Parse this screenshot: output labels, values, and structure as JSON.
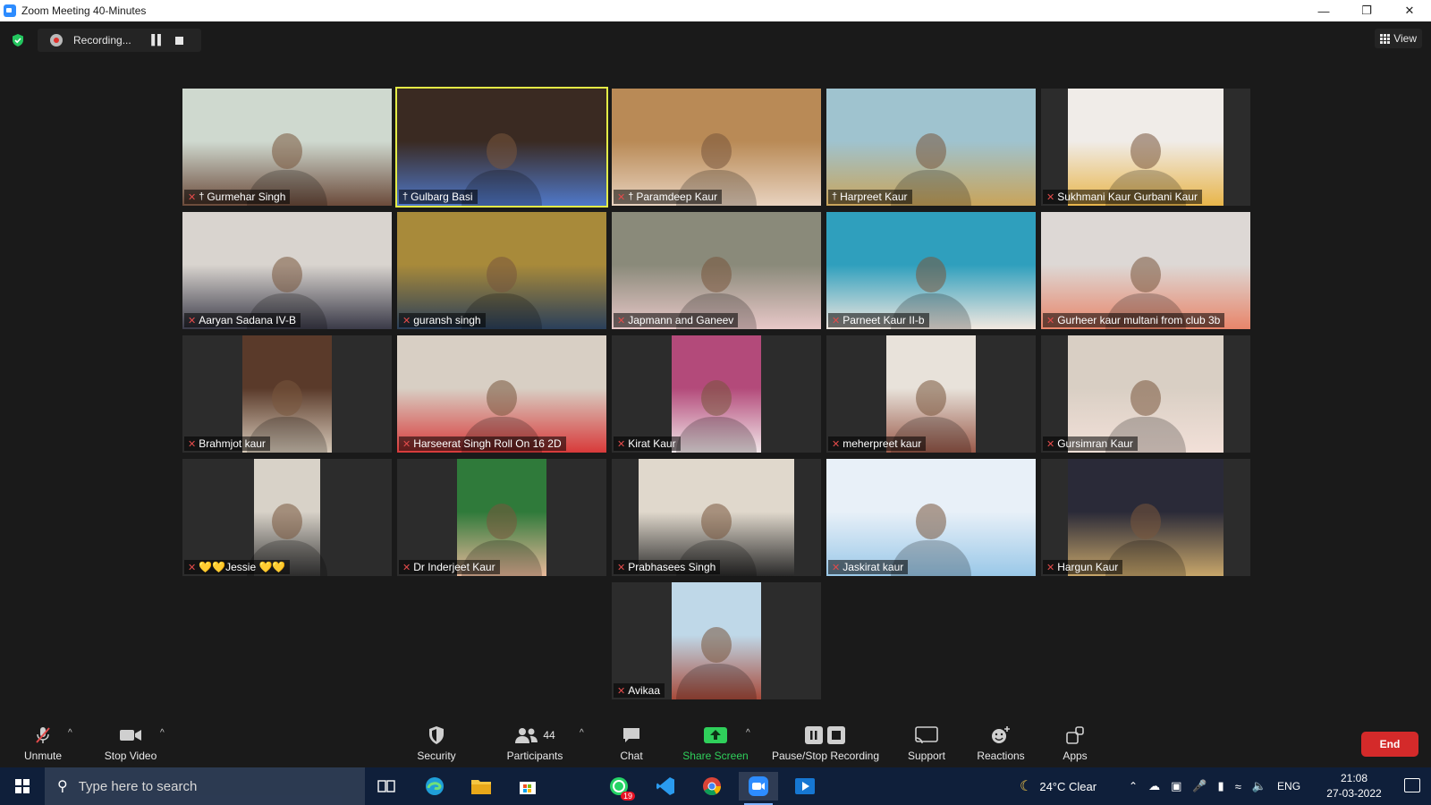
{
  "window": {
    "title": "Zoom Meeting 40-Minutes",
    "minimize": "—",
    "restore": "❐",
    "close": "✕"
  },
  "recording": {
    "status": "Recording...",
    "pause_symbol": "▌▌"
  },
  "view_button": {
    "label": "View"
  },
  "participants": [
    {
      "name": "Gurmehar Singh",
      "muted": true,
      "pinned": true
    },
    {
      "name": "Gulbarg Basi",
      "muted": false,
      "pinned": true,
      "active": true
    },
    {
      "name": "Paramdeep Kaur",
      "muted": true,
      "pinned": true
    },
    {
      "name": "Harpreet Kaur",
      "muted": false,
      "pinned": true
    },
    {
      "name": "Sukhmani Kaur Gurbani Kaur",
      "muted": true,
      "pinned": false
    },
    {
      "name": "Aaryan Sadana IV-B",
      "muted": true,
      "pinned": false
    },
    {
      "name": "guransh singh",
      "muted": true,
      "pinned": false
    },
    {
      "name": "Japmann and Ganeev",
      "muted": true,
      "pinned": false
    },
    {
      "name": "Parneet Kaur II-b",
      "muted": true,
      "pinned": false
    },
    {
      "name": "Gurheer kaur multani from club 3b",
      "muted": true,
      "pinned": false
    },
    {
      "name": "Brahmjot kaur",
      "muted": true,
      "pinned": false
    },
    {
      "name": "Harseerat Singh Roll On 16 2D",
      "muted": true,
      "pinned": false
    },
    {
      "name": "Kirat Kaur",
      "muted": true,
      "pinned": false
    },
    {
      "name": "meherpreet kaur",
      "muted": true,
      "pinned": false
    },
    {
      "name": "Gursimran Kaur",
      "muted": true,
      "pinned": false
    },
    {
      "name": "💛💛Jessie 💛💛",
      "muted": true,
      "pinned": false
    },
    {
      "name": "Dr Inderjeet Kaur",
      "muted": true,
      "pinned": false
    },
    {
      "name": "Prabhasees Singh",
      "muted": true,
      "pinned": false
    },
    {
      "name": "Jaskirat kaur",
      "muted": true,
      "pinned": false
    },
    {
      "name": "Hargun Kaur",
      "muted": true,
      "pinned": false
    },
    {
      "name": "Avikaa",
      "muted": true,
      "pinned": false
    }
  ],
  "toolbar": {
    "unmute": "Unmute",
    "stop_video": "Stop Video",
    "security": "Security",
    "participants": "Participants",
    "participant_count": "44",
    "chat": "Chat",
    "share_screen": "Share Screen",
    "pause_stop_recording": "Pause/Stop Recording",
    "support": "Support",
    "reactions": "Reactions",
    "apps": "Apps",
    "end": "End"
  },
  "taskbar": {
    "search_placeholder": "Type here to search",
    "whatsapp_badge": "19",
    "weather": "24°C  Clear",
    "language": "ENG",
    "time": "21:08",
    "date": "27-03-2022"
  }
}
